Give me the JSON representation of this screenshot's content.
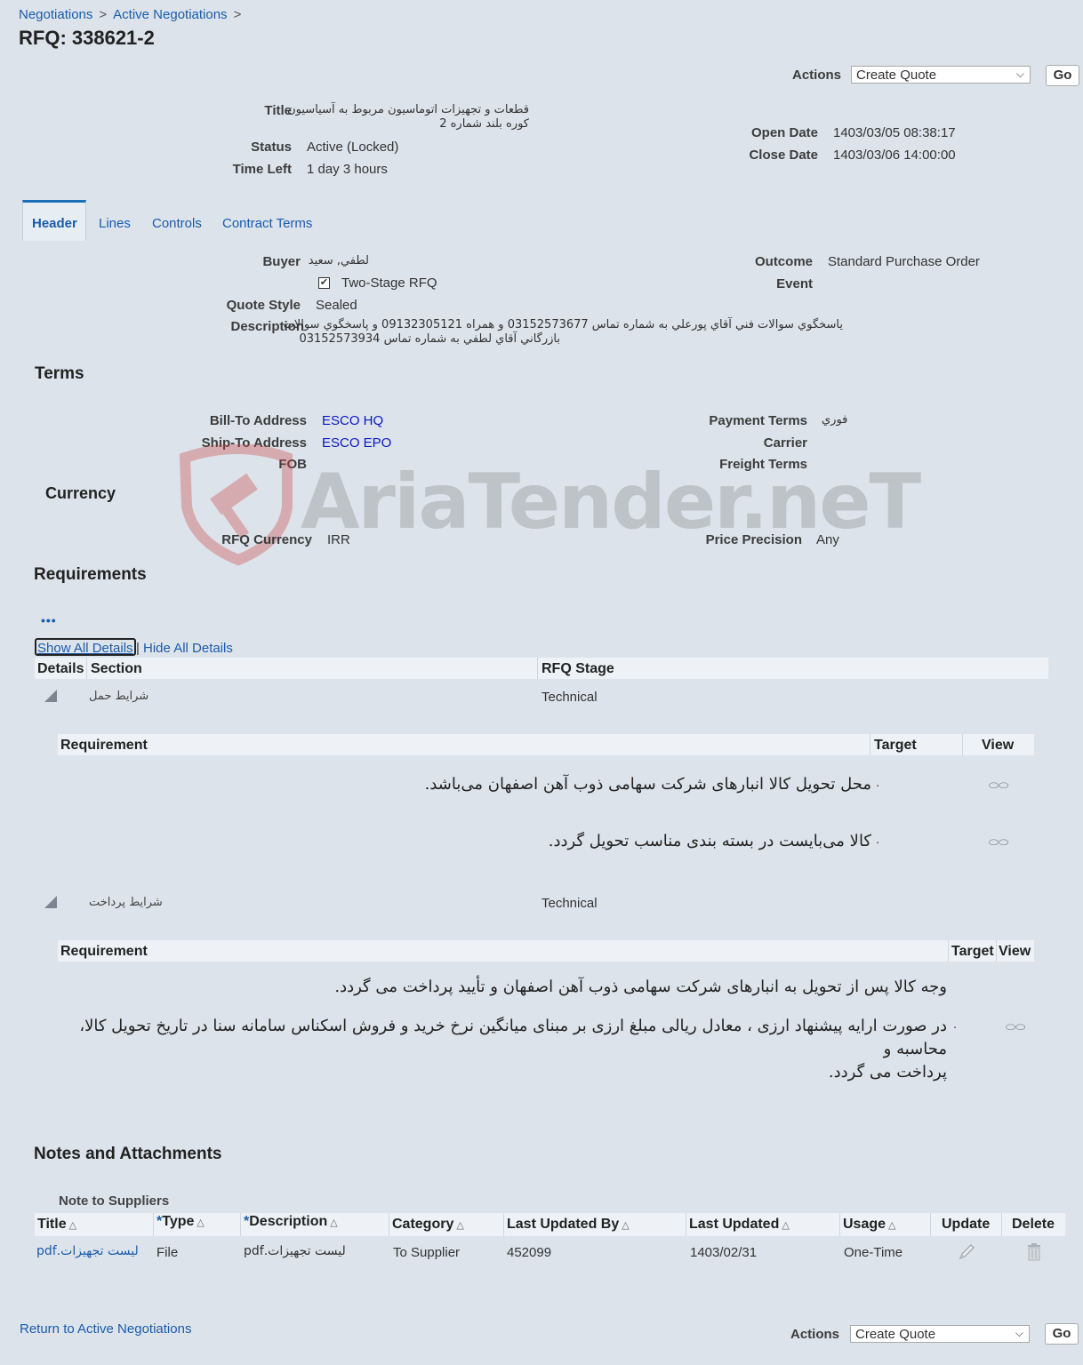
{
  "breadcrumb": [
    "Negotiations",
    "Active Negotiations"
  ],
  "page_title": "RFQ: 338621-2",
  "actions": {
    "label": "Actions",
    "selected": "Create Quote",
    "go": "Go"
  },
  "summary": {
    "title_label": "Title",
    "title_value_line1": "قطعات و تجهیزات اتوماسیون مربوط به آسیاسیون",
    "title_value_line2": "کوره بلند شماره 2",
    "status_label": "Status",
    "status_value": "Active (Locked)",
    "time_left_label": "Time Left",
    "time_left_value": "1 day 3 hours",
    "open_date_label": "Open Date",
    "open_date_value": "1403/03/05 08:38:17",
    "close_date_label": "Close Date",
    "close_date_value": "1403/03/06 14:00:00"
  },
  "tabs": [
    "Header",
    "Lines",
    "Controls",
    "Contract Terms"
  ],
  "header": {
    "buyer_label": "Buyer",
    "buyer_value": "لطفي, سعيد",
    "two_stage_label": "Two-Stage RFQ",
    "two_stage_checked": true,
    "quote_style_label": "Quote Style",
    "quote_style_value": "Sealed",
    "description_label": "Description",
    "description_line1": "ياسخگوي سوالات فني آقاي پورعلي به شماره تماس 03152573677 و همراه 09132305121 و پاسخگوي سوالات",
    "description_line2": "بازرگاني آقاي لطفي به شماره تماس 03152573934",
    "outcome_label": "Outcome",
    "outcome_value": "Standard Purchase Order",
    "event_label": "Event"
  },
  "terms": {
    "heading": "Terms",
    "bill_to_label": "Bill-To Address",
    "bill_to_value": "ESCO HQ",
    "ship_to_label": "Ship-To Address",
    "ship_to_value": "ESCO EPO",
    "fob_label": "FOB",
    "payment_terms_label": "Payment Terms",
    "payment_terms_value": "فوري",
    "carrier_label": "Carrier",
    "freight_terms_label": "Freight Terms"
  },
  "currency": {
    "heading": "Currency",
    "rfq_currency_label": "RFQ Currency",
    "rfq_currency_value": "IRR",
    "price_precision_label": "Price Precision",
    "price_precision_value": "Any"
  },
  "watermark": "AriaTender.neT",
  "requirements": {
    "heading": "Requirements",
    "more_icon": "•••",
    "show_all": "Show All Details",
    "separator": "|",
    "hide_all": "Hide All Details",
    "columns": [
      "Details",
      "Section",
      "RFQ Stage"
    ],
    "sub_columns": [
      "Requirement",
      "Target",
      "View"
    ],
    "sections": [
      {
        "name": "شرايط حمل",
        "stage": "Technical",
        "items": [
          "محل تحویل کالا انبارهای شرکت سهامی ذوب آهن اصفهان می‌باشد.",
          "کالا می‌بایست در بسته بندی مناسب تحویل گردد."
        ]
      },
      {
        "name": "شرايط پرداخت",
        "stage": "Technical",
        "items": [
          "وجه کالا پس از تحویل به انبارهای شرکت سهامی ذوب آهن اصفهان و تأیید پرداخت می گردد.",
          "در صورت ارایه پیشنهاد ارزی ، معادل ریالی مبلغ ارزی بر مبنای میانگین نرخ خرید و فروش اسکناس سامانه سنا در تاریخ تحویل کالا، محاسبه و",
          "پرداخت می گردد."
        ]
      }
    ],
    "item_marker": "."
  },
  "notes": {
    "heading": "Notes and Attachments",
    "note_label": "Note to Suppliers",
    "columns": [
      "Title",
      "Type",
      "Description",
      "Category",
      "Last Updated By",
      "Last Updated",
      "Usage",
      "Update",
      "Delete"
    ],
    "required_mark": "*",
    "rows": [
      {
        "title": "لیست تجهیزات.pdf",
        "type": "File",
        "description": "لیست تجهیزات.pdf",
        "category": "To Supplier",
        "last_updated_by": "452099",
        "last_updated": "1403/02/31",
        "usage": "One-Time"
      }
    ]
  },
  "footer": {
    "return_link": "Return to Active Negotiations"
  }
}
